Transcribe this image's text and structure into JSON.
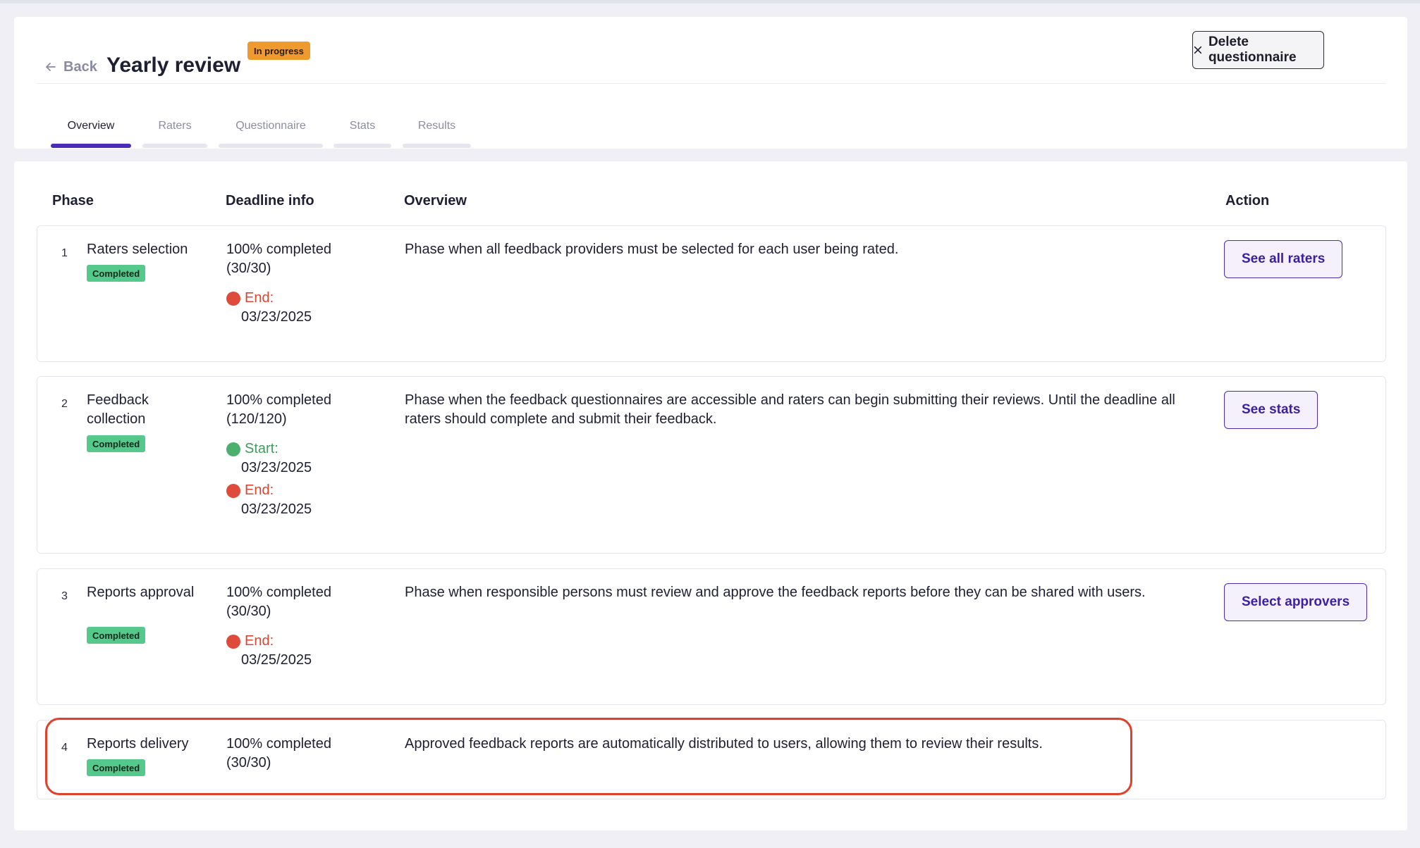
{
  "header": {
    "back_label": "Back",
    "title": "Yearly review",
    "status": "In progress",
    "delete_label": "Delete questionnaire",
    "tabs": [
      "Overview",
      "Raters",
      "Questionnaire",
      "Stats",
      "Results"
    ],
    "active_tab": "Overview"
  },
  "table": {
    "columns": {
      "phase": "Phase",
      "deadline": "Deadline info",
      "overview": "Overview",
      "action": "Action"
    },
    "rows": [
      {
        "num": "1",
        "name": "Raters selection",
        "badge": "Completed",
        "progress": "100% completed (30/30)",
        "end_label": "End:",
        "end_date": "03/23/2025",
        "overview": "Phase when all feedback providers must be selected for each user being rated.",
        "action": "See all raters"
      },
      {
        "num": "2",
        "name": "Feedback collection",
        "badge": "Completed",
        "progress": "100% completed (120/120)",
        "start_label": "Start:",
        "start_date": "03/23/2025",
        "end_label": "End:",
        "end_date": "03/23/2025",
        "overview": "Phase when the feedback questionnaires are accessible and raters can begin submitting their reviews. Until the deadline all raters should complete and submit their feedback.",
        "action": "See stats"
      },
      {
        "num": "3",
        "name": "Reports approval",
        "badge": "Completed",
        "progress": "100% completed (30/30)",
        "end_label": "End:",
        "end_date": "03/25/2025",
        "overview": "Phase when responsible persons must review and approve the feedback reports before they can be shared with users.",
        "action": "Select approvers"
      },
      {
        "num": "4",
        "name": "Reports delivery",
        "badge": "Completed",
        "progress": "100% completed (30/30)",
        "overview": "Approved feedback reports are automatically distributed  to users, allowing them to review their results."
      }
    ]
  },
  "colors": {
    "accent": "#4b2bb8",
    "status_in_progress": "#ef9a2e",
    "badge_completed": "#55c98c",
    "end_red": "#df4b3a",
    "start_green": "#4caf6e",
    "highlight": "#e0412b"
  },
  "icons": {
    "back": "arrow-left-icon",
    "delete": "close-icon"
  }
}
